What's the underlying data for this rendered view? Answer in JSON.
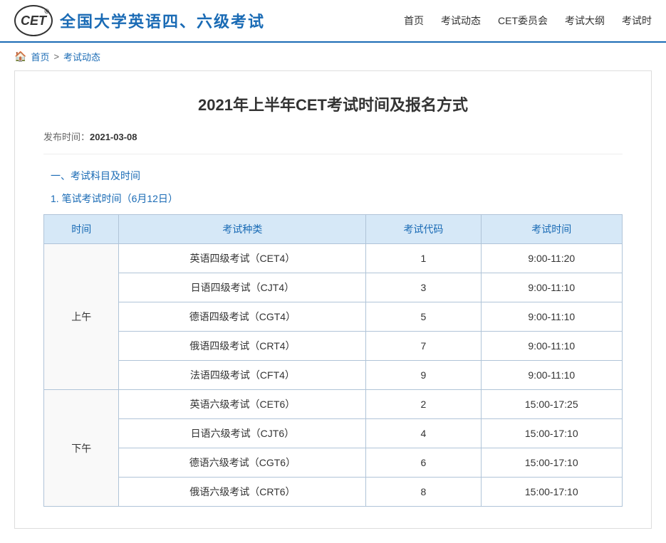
{
  "header": {
    "logo_text": "CET",
    "logo_reg": "®",
    "site_title": "全国大学英语四、六级考试",
    "nav": [
      {
        "id": "home",
        "label": "首页"
      },
      {
        "id": "news",
        "label": "考试动态"
      },
      {
        "id": "committee",
        "label": "CET委员会"
      },
      {
        "id": "syllabus",
        "label": "考试大纲"
      },
      {
        "id": "exam",
        "label": "考试时"
      }
    ]
  },
  "breadcrumb": {
    "home_icon": "🏠",
    "items": [
      {
        "label": "首页",
        "href": "#"
      },
      {
        "separator": ">"
      },
      {
        "label": "考试动态",
        "href": "#"
      }
    ]
  },
  "article": {
    "title": "2021年上半年CET考试时间及报名方式",
    "publish_label": "发布时间：",
    "publish_date": "2021-03-08",
    "section1_title": "一、考试科目及时间",
    "sub_title1": "1. 笔试考试时间（6月12日）",
    "table": {
      "headers": [
        "时间",
        "考试种类",
        "考试代码",
        "考试时间"
      ],
      "rows": [
        {
          "time": "上午",
          "rowspan": 5,
          "items": [
            {
              "name": "英语四级考试（CET4）",
              "code": "1",
              "period": "9:00-11:20"
            },
            {
              "name": "日语四级考试（CJT4）",
              "code": "3",
              "period": "9:00-11:10"
            },
            {
              "name": "德语四级考试（CGT4）",
              "code": "5",
              "period": "9:00-11:10"
            },
            {
              "name": "俄语四级考试（CRT4）",
              "code": "7",
              "period": "9:00-11:10"
            },
            {
              "name": "法语四级考试（CFT4）",
              "code": "9",
              "period": "9:00-11:10"
            }
          ]
        },
        {
          "time": "下午",
          "rowspan": 4,
          "items": [
            {
              "name": "英语六级考试（CET6）",
              "code": "2",
              "period": "15:00-17:25"
            },
            {
              "name": "日语六级考试（CJT6）",
              "code": "4",
              "period": "15:00-17:10"
            },
            {
              "name": "德语六级考试（CGT6）",
              "code": "6",
              "period": "15:00-17:10"
            },
            {
              "name": "俄语六级考试（CRT6）",
              "code": "8",
              "period": "15:00-17:10"
            }
          ]
        }
      ]
    }
  },
  "colors": {
    "brand_blue": "#1a6bb5",
    "table_header_bg": "#d6e8f7",
    "table_border": "#b0c4d8"
  }
}
